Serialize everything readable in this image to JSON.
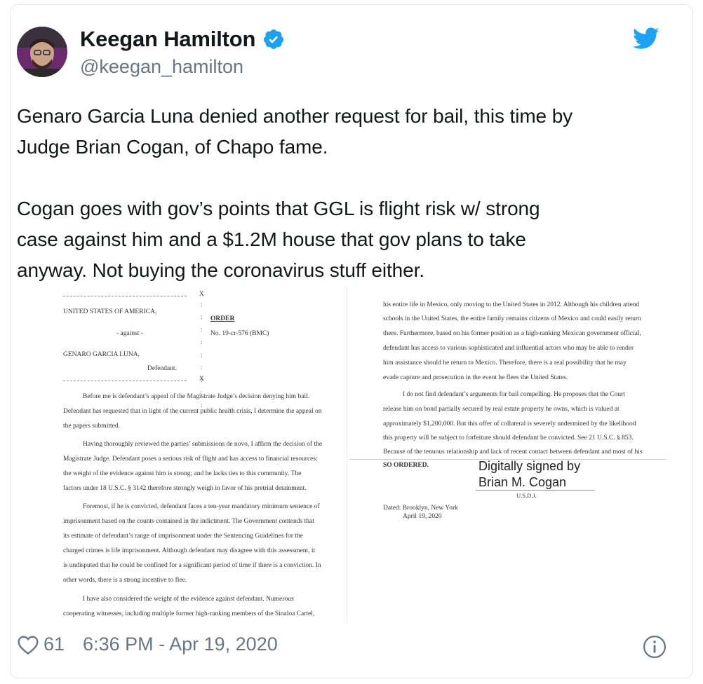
{
  "header": {
    "display_name": "Keegan Hamilton",
    "handle": "@keegan_hamilton"
  },
  "tweet": {
    "text": "Genaro Garcia Luna denied another request for bail, this time by\nJudge Brian Cogan, of Chapo fame.\n\nCogan goes with gov’s points that GGL is flight risk w/ strong\ncase against him and a $1.2M house that gov plans to take\nanyway. Not buying the coronavirus stuff either."
  },
  "document": {
    "left": {
      "caption_party1": "UNITED STATES OF AMERICA,",
      "caption_against": "- against -",
      "caption_party2": "GENARO GARCIA LUNA,",
      "caption_defendant": "Defendant.",
      "title": "ORDER",
      "case_no": "No. 19-cr-576 (BMC)",
      "x_mark": "X",
      "lines": [
        "Before me is defendant’s appeal of the Magistrate Judge’s decision denying him bail.",
        "Defendant has requested that in light of the current public health crisis, I determine the appeal on",
        "the papers submitted.",
        "Having thoroughly reviewed the parties’ submissions de novo, I affirm the decision of the",
        "Magistrate Judge.  Defendant poses a serious risk of flight and has access to financial resources;",
        "the weight of the evidence against him is strong; and he lacks ties to this community.  The",
        "factors under 18 U.S.C. § 3142 therefore strongly weigh in favor of his pretrial detainment.",
        "Foremost, if he is convicted, defendant faces a ten-year mandatory minimum sentence of",
        "imprisonment based on the counts contained in the indictment.  The Government contends that",
        "its estimate of defendant’s range of imprisonment under the Sentencing Guidelines for the",
        "charged crimes is life imprisonment.  Although defendant may disagree with this assessment, it",
        "is undisputed that he could be confined for a significant period of time if there is a conviction.  In",
        "other words, there is a strong incentive to flee.",
        "I have also considered the weight of the evidence against defendant.  Numerous",
        "cooperating witnesses, including multiple former high-ranking members of the Sinaloa Cartel,"
      ]
    },
    "right": {
      "lines": [
        "his entire life in Mexico, only moving to the United States in 2012.  Although his children attend",
        "schools in the United States, the entire family remains citizens of Mexico and could easily return",
        "there.  Furthermore, based on his former position as a high-ranking Mexican government official,",
        "defendant has access to various sophisticated and influential actors who may be able to render",
        "him assistance should he return to Mexico.  Therefore, there is a real possibility that he may",
        "evade capture and prosecution in the event he flees the United States.",
        "I do not find defendant’s arguments for bail compelling.  He proposes that the Court",
        "release him on bond partially secured by real estate property he owns, which is valued at",
        "approximately $1,200,000.  But this offer of collateral is severely undermined by the likelihood",
        "this property will be subject to forfeiture should defendant be convicted.  See 21 U.S.C. § 853.",
        "Because of the tenuous relationship and lack of recent contact between defendant and most of his"
      ],
      "so_ordered": "SO ORDERED.",
      "sig_line1": "Digitally signed by",
      "sig_line2": "Brian M. Cogan",
      "usdj": "U.S.D.J.",
      "dated1": "Dated: Brooklyn, New York",
      "dated2": "April 19, 2020"
    }
  },
  "footer": {
    "likes": "61",
    "timestamp": "6:36 PM - Apr 19, 2020"
  },
  "colors": {
    "text_primary": "#14171a",
    "text_secondary": "#657786",
    "twitter_blue": "#1da1f2",
    "border": "#e1e8ed"
  },
  "icons": [
    "verified-badge-icon",
    "twitter-bird-icon",
    "heart-icon",
    "info-icon"
  ]
}
